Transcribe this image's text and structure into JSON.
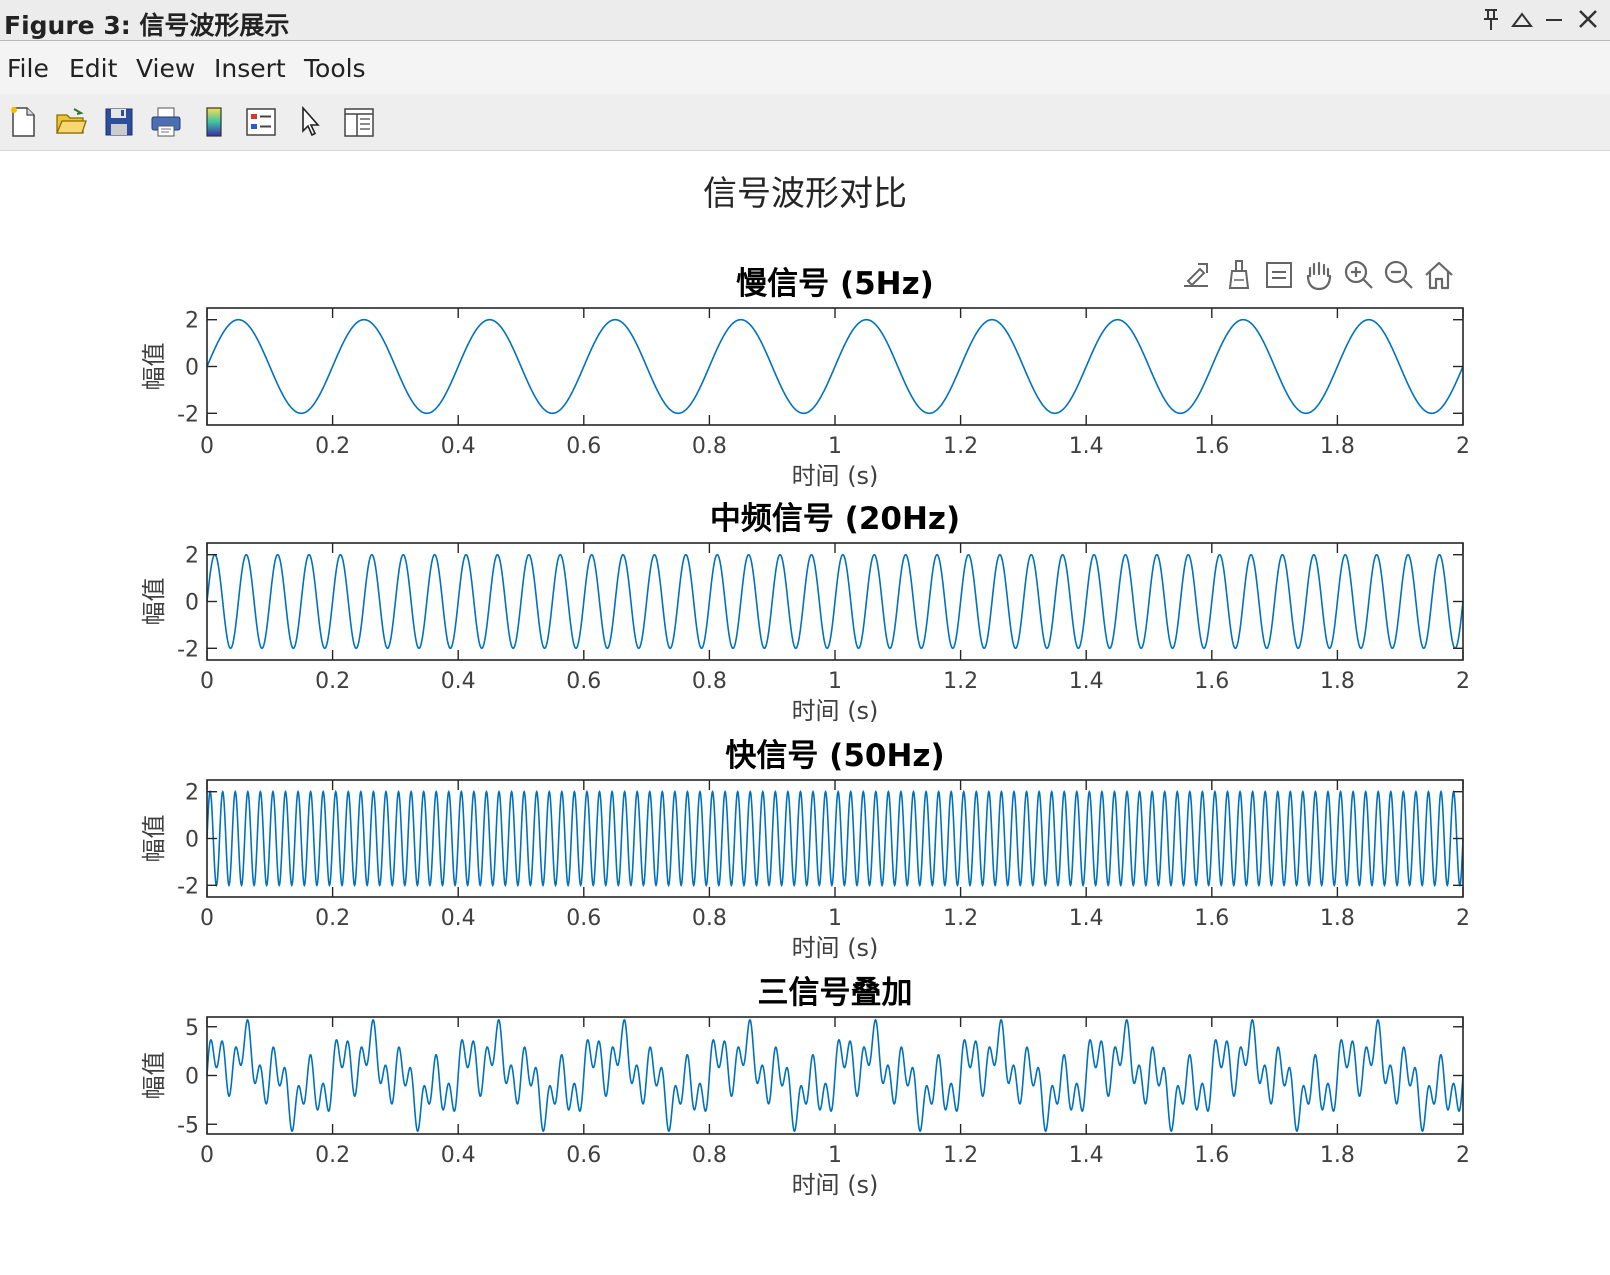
{
  "window": {
    "title": "Figure 3: 信号波形展示",
    "controls": {
      "pin": "pin-icon",
      "maximize": "triangle-up-icon",
      "minimize": "minimize-icon",
      "close": "close-icon"
    }
  },
  "menu": [
    "File",
    "Edit",
    "View",
    "Insert",
    "Tools"
  ],
  "toolbar": [
    "new-figure-icon",
    "open-folder-icon",
    "save-icon",
    "print-icon",
    "colorbar-icon",
    "legend-icon",
    "pointer-icon",
    "property-inspector-icon"
  ],
  "axes_toolbar": [
    "export-icon",
    "brush-icon",
    "datatip-icon",
    "pan-hand-icon",
    "zoom-in-icon",
    "zoom-out-icon",
    "home-icon"
  ],
  "figure_title": "信号波形对比",
  "colors": {
    "line": "#0072BD",
    "axis": "#262626",
    "tick_label": "#404040"
  },
  "chart_data": [
    {
      "type": "line",
      "title": "慢信号 (5Hz)",
      "xlabel": "时间 (s)",
      "ylabel": "幅值",
      "xlim": [
        0,
        2
      ],
      "ylim": [
        -2.5,
        2.5
      ],
      "xticks": [
        0,
        0.2,
        0.4,
        0.6,
        0.8,
        1,
        1.2,
        1.4,
        1.6,
        1.8,
        2
      ],
      "xticklabels": [
        "0",
        "0.2",
        "0.4",
        "0.6",
        "0.8",
        "1",
        "1.2",
        "1.4",
        "1.6",
        "1.8",
        "2"
      ],
      "yticks": [
        -2,
        0,
        2
      ],
      "yticklabels": [
        "-2",
        "0",
        "2"
      ],
      "series": [
        {
          "function": "2*sin(2*pi*5*t)",
          "amplitude": 2,
          "frequency_hz": 5,
          "t_start": 0,
          "t_end": 2
        }
      ]
    },
    {
      "type": "line",
      "title": "中频信号 (20Hz)",
      "xlabel": "时间 (s)",
      "ylabel": "幅值",
      "xlim": [
        0,
        2
      ],
      "ylim": [
        -2.5,
        2.5
      ],
      "xticks": [
        0,
        0.2,
        0.4,
        0.6,
        0.8,
        1,
        1.2,
        1.4,
        1.6,
        1.8,
        2
      ],
      "xticklabels": [
        "0",
        "0.2",
        "0.4",
        "0.6",
        "0.8",
        "1",
        "1.2",
        "1.4",
        "1.6",
        "1.8",
        "2"
      ],
      "yticks": [
        -2,
        0,
        2
      ],
      "yticklabels": [
        "-2",
        "0",
        "2"
      ],
      "series": [
        {
          "function": "2*sin(2*pi*20*t)",
          "amplitude": 2,
          "frequency_hz": 20,
          "t_start": 0,
          "t_end": 2
        }
      ]
    },
    {
      "type": "line",
      "title": "快信号 (50Hz)",
      "xlabel": "时间 (s)",
      "ylabel": "幅值",
      "xlim": [
        0,
        2
      ],
      "ylim": [
        -2.5,
        2.5
      ],
      "xticks": [
        0,
        0.2,
        0.4,
        0.6,
        0.8,
        1,
        1.2,
        1.4,
        1.6,
        1.8,
        2
      ],
      "xticklabels": [
        "0",
        "0.2",
        "0.4",
        "0.6",
        "0.8",
        "1",
        "1.2",
        "1.4",
        "1.6",
        "1.8",
        "2"
      ],
      "yticks": [
        -2,
        0,
        2
      ],
      "yticklabels": [
        "-2",
        "0",
        "2"
      ],
      "series": [
        {
          "function": "2*sin(2*pi*50*t)",
          "amplitude": 2,
          "frequency_hz": 50,
          "t_start": 0,
          "t_end": 2
        }
      ]
    },
    {
      "type": "line",
      "title": "三信号叠加",
      "xlabel": "时间 (s)",
      "ylabel": "幅值",
      "xlim": [
        0,
        2
      ],
      "ylim": [
        -6,
        6
      ],
      "xticks": [
        0,
        0.2,
        0.4,
        0.6,
        0.8,
        1,
        1.2,
        1.4,
        1.6,
        1.8,
        2
      ],
      "xticklabels": [
        "0",
        "0.2",
        "0.4",
        "0.6",
        "0.8",
        "1",
        "1.2",
        "1.4",
        "1.6",
        "1.8",
        "2"
      ],
      "yticks": [
        -5,
        0,
        5
      ],
      "yticklabels": [
        "-5",
        "0",
        "5"
      ],
      "series": [
        {
          "function": "2*sin(2*pi*5*t)+2*sin(2*pi*20*t)+2*sin(2*pi*50*t)",
          "components_hz": [
            5,
            20,
            50
          ],
          "amplitude_each": 2,
          "t_start": 0,
          "t_end": 2
        }
      ]
    }
  ]
}
